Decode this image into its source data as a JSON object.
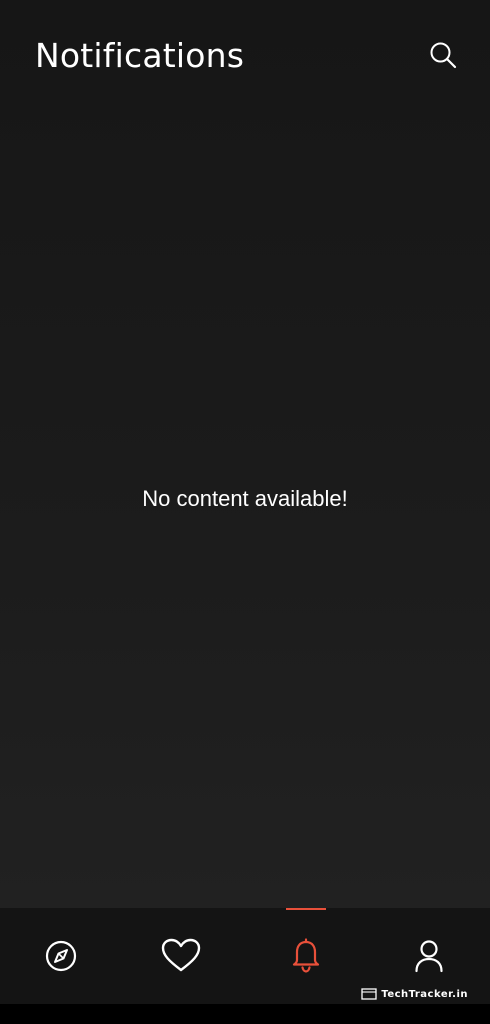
{
  "header": {
    "title": "Notifications",
    "search_icon": "search-icon"
  },
  "main": {
    "empty_message": "No content available!"
  },
  "bottom_nav": {
    "active_index": 2,
    "active_color": "#e8503a",
    "items": [
      {
        "icon": "compass-icon",
        "active": false
      },
      {
        "icon": "heart-icon",
        "active": false
      },
      {
        "icon": "bell-icon",
        "active": true
      },
      {
        "icon": "user-icon",
        "active": false
      }
    ]
  },
  "watermark": {
    "text": "TechTracker.in"
  },
  "colors": {
    "background": "#1c1c1c",
    "nav_background": "#141414",
    "text": "#ffffff",
    "accent": "#e8503a"
  }
}
